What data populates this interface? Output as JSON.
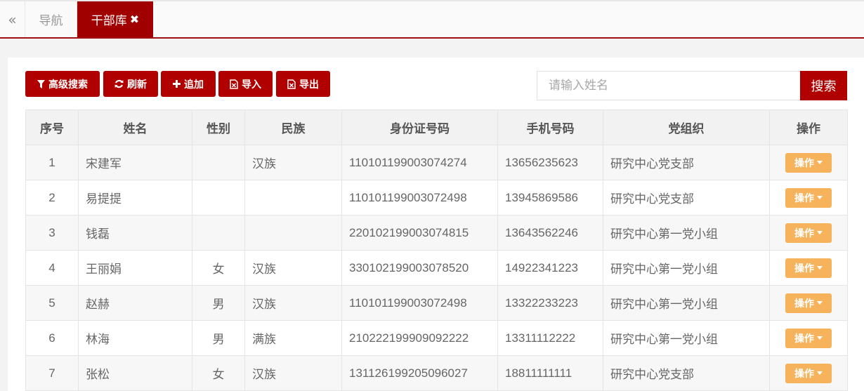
{
  "tabs": {
    "collapse": "«",
    "nav": "导航",
    "active": "干部库",
    "close": "✖"
  },
  "toolbar": {
    "advanced_search": "高级搜索",
    "refresh": "刷新",
    "add": "追加",
    "import": "导入",
    "export": "导出"
  },
  "search": {
    "placeholder": "请输入姓名",
    "button": "搜索"
  },
  "table": {
    "headers": [
      "序号",
      "姓名",
      "性别",
      "民族",
      "身份证号码",
      "手机号码",
      "党组织",
      "操作"
    ],
    "op_label": "操作",
    "rows": [
      {
        "no": "1",
        "name": "宋建军",
        "gender": "",
        "ethnicity": "汉族",
        "id": "110101199003074274",
        "phone": "13656235623",
        "org": "研究中心党支部"
      },
      {
        "no": "2",
        "name": "易提提",
        "gender": "",
        "ethnicity": "",
        "id": "110101199003072498",
        "phone": "13945869586",
        "org": "研究中心党支部"
      },
      {
        "no": "3",
        "name": "钱磊",
        "gender": "",
        "ethnicity": "",
        "id": "220102199003074815",
        "phone": "13643562246",
        "org": "研究中心第一党小组"
      },
      {
        "no": "4",
        "name": "王丽娟",
        "gender": "女",
        "ethnicity": "汉族",
        "id": "330102199003078520",
        "phone": "14922341223",
        "org": "研究中心第一党小组"
      },
      {
        "no": "5",
        "name": "赵赫",
        "gender": "男",
        "ethnicity": "汉族",
        "id": "110101199003072498",
        "phone": "13322233223",
        "org": "研究中心第一党小组"
      },
      {
        "no": "6",
        "name": "林海",
        "gender": "男",
        "ethnicity": "满族",
        "id": "210222199909092222",
        "phone": "13311112222",
        "org": "研究中心第一党小组"
      },
      {
        "no": "7",
        "name": "张松",
        "gender": "女",
        "ethnicity": "汉族",
        "id": "131126199205096027",
        "phone": "18811111111",
        "org": "研究中心党支部"
      }
    ]
  }
}
